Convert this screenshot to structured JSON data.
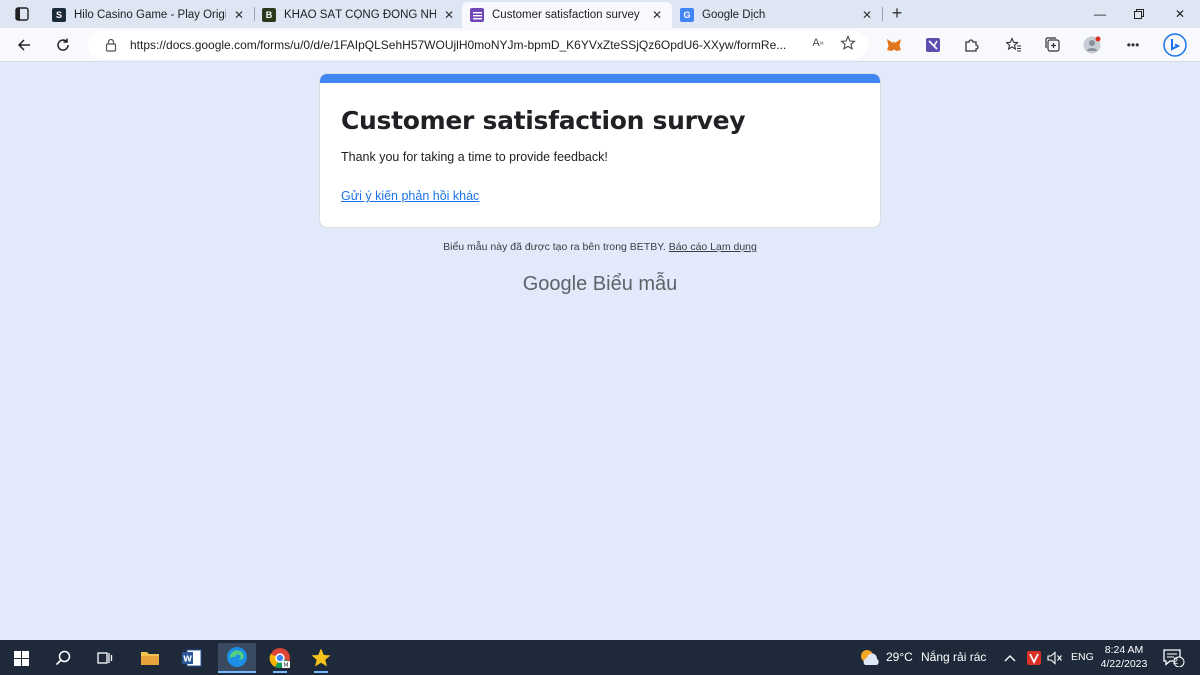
{
  "tabs": [
    {
      "title": "Hilo Casino Game - Play Original",
      "favicon": "S",
      "favicon_color": "#1c2b3a"
    },
    {
      "title": "KHẢO SÁT CỘNG ĐỒNG NHÀ CÁI",
      "favicon": "B",
      "favicon_color": "#2b3a1c"
    },
    {
      "title": "Customer satisfaction survey",
      "favicon": "forms-icon",
      "favicon_color": "#7248b9"
    },
    {
      "title": "Google Dịch",
      "favicon": "translate-icon",
      "favicon_color": "#4285f4"
    }
  ],
  "address_bar": {
    "url": "https://docs.google.com/forms/u/0/d/e/1FAIpQLSehH57WOUjlH0moNYJm-bpmD_K6YVxZteSSjQz6OpdU6-XXyw/formRe..."
  },
  "form": {
    "title": "Customer satisfaction survey",
    "confirmation": "Thank you for taking a time to provide feedback!",
    "submit_another": "Gửi ý kiến phản hồi khác",
    "accent_color": "#4285f4"
  },
  "footer": {
    "note": "Biểu mẫu này đã được tạo ra bên trong BETBY.",
    "report_abuse": "Báo cáo Lạm dụng",
    "brand_google": "Google",
    "brand_forms": "Biểu mẫu"
  },
  "taskbar": {
    "weather_temp": "29°C",
    "weather_desc": "Nắng rải rác",
    "language": "ENG",
    "time": "8:24 AM",
    "date": "4/22/2023",
    "notifications": "2"
  }
}
